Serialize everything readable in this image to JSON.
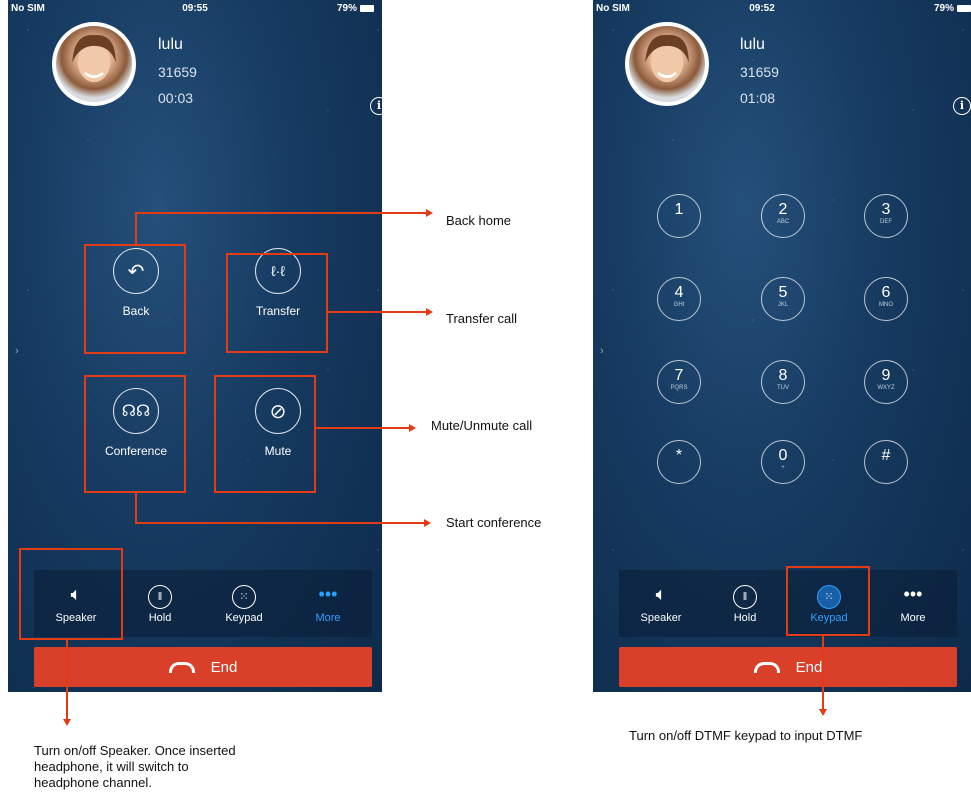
{
  "left_phone": {
    "status": {
      "carrier": "No SIM",
      "time": "09:55",
      "battery": "79%"
    },
    "contact": {
      "name": "lulu",
      "number": "31659",
      "duration": "00:03"
    },
    "actions": [
      {
        "label": "Back",
        "icon": "back-arrow-icon"
      },
      {
        "label": "Transfer",
        "icon": "transfer-call-icon"
      },
      {
        "label": "Conference",
        "icon": "conference-icon"
      },
      {
        "label": "Mute",
        "icon": "mute-mic-icon"
      }
    ],
    "bar": [
      {
        "label": "Speaker",
        "icon": "speaker-icon"
      },
      {
        "label": "Hold",
        "icon": "pause-icon"
      },
      {
        "label": "Keypad",
        "icon": "keypad-icon"
      },
      {
        "label": "More",
        "icon": "more-dots-icon"
      }
    ],
    "end_label": "End"
  },
  "right_phone": {
    "status": {
      "carrier": "No SIM",
      "time": "09:52",
      "battery": "79%"
    },
    "contact": {
      "name": "lulu",
      "number": "31659",
      "duration": "01:08"
    },
    "keys": [
      {
        "digit": "1",
        "sub": ""
      },
      {
        "digit": "2",
        "sub": "ABC"
      },
      {
        "digit": "3",
        "sub": "DEF"
      },
      {
        "digit": "4",
        "sub": "GHI"
      },
      {
        "digit": "5",
        "sub": "JKL"
      },
      {
        "digit": "6",
        "sub": "MNO"
      },
      {
        "digit": "7",
        "sub": "PQRS"
      },
      {
        "digit": "8",
        "sub": "TUV"
      },
      {
        "digit": "9",
        "sub": "WXYZ"
      },
      {
        "digit": "*",
        "sub": ""
      },
      {
        "digit": "0",
        "sub": "+"
      },
      {
        "digit": "#",
        "sub": ""
      }
    ],
    "bar": [
      {
        "label": "Speaker",
        "icon": "speaker-icon"
      },
      {
        "label": "Hold",
        "icon": "pause-icon"
      },
      {
        "label": "Keypad",
        "icon": "keypad-icon"
      },
      {
        "label": "More",
        "icon": "more-dots-icon"
      }
    ],
    "end_label": "End"
  },
  "annotations": {
    "back_home": "Back home",
    "transfer_call": "Transfer call",
    "mute_unmute": "Mute/Unmute call",
    "start_conference": "Start conference",
    "speaker_note_1": "Turn on/off Speaker. Once inserted",
    "speaker_note_2": "headphone, it will switch to",
    "speaker_note_3": "headphone channel.",
    "dtmf_note": "Turn on/off DTMF keypad to input DTMF"
  },
  "colors": {
    "annotation_red": "#e23b16",
    "end_button": "#d9402a",
    "accent_blue": "#2ea0ff"
  }
}
